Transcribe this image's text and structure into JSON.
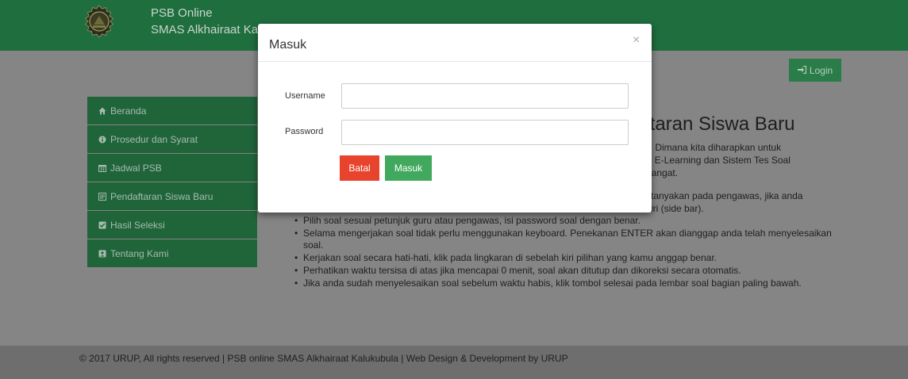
{
  "header": {
    "title_line1": "PSB Online",
    "title_line2": "SMAS Alkhairaat Ka"
  },
  "toolbar": {
    "login_label": "Login"
  },
  "sidebar": {
    "items": [
      {
        "label": "Beranda",
        "icon": "home-icon"
      },
      {
        "label": "Prosedur dan Syarat",
        "icon": "info-circle-icon"
      },
      {
        "label": "Jadwal PSB",
        "icon": "calendar-icon"
      },
      {
        "label": "Pendaftaran Siswa Baru",
        "icon": "form-icon"
      },
      {
        "label": "Hasil Seleksi",
        "icon": "check-square-icon"
      },
      {
        "label": "Tentang Kami",
        "icon": "user-card-icon"
      }
    ]
  },
  "main": {
    "heading": "ftaran Siswa Baru",
    "intro_lines": [
      "g. Dimana kita diharapkan untuk",
      "ui E-Learning dan Sistem Tes Soal",
      " Hangat."
    ],
    "partial_lines": [
      "tanyakan pada pengawas, jika anda",
      "iri (side bar)."
    ],
    "rules": [
      "Pilih soal sesuai petunjuk guru atau pengawas, isi password soal dengan benar.",
      "Selama mengerjakan soal tidak perlu menggunakan keyboard. Penekanan ENTER akan dianggap anda telah menyelesaikan soal.",
      "Kerjakan soal secara hati-hati, klik pada lingkaran di sebelah kiri pilihan yang kamu anggap benar.",
      "Perhatikan waktu tersisa di atas jika mencapai 0 menit, soal akan ditutup dan dikoreksi secara otomatis.",
      "Jika anda sudah menyelesaikan soal sebelum waktu habis, klik tombol selesai pada lembar soal bagian paling bawah."
    ]
  },
  "footer": {
    "text": "© 2017 URUP, All rights reserved | PSB online SMAS Alkhairaat Kalukubula | Web Design & Development by URUP"
  },
  "modal": {
    "title": "Masuk",
    "close_label": "×",
    "username_label": "Username",
    "username_value": "",
    "password_label": "Password",
    "password_value": "",
    "cancel_label": "Batal",
    "submit_label": "Masuk"
  },
  "colors": {
    "header": "#1f6e3e",
    "nav_item": "#20643a",
    "cancel": "#e8432c",
    "submit": "#41a95d",
    "overlay": "#858585"
  }
}
